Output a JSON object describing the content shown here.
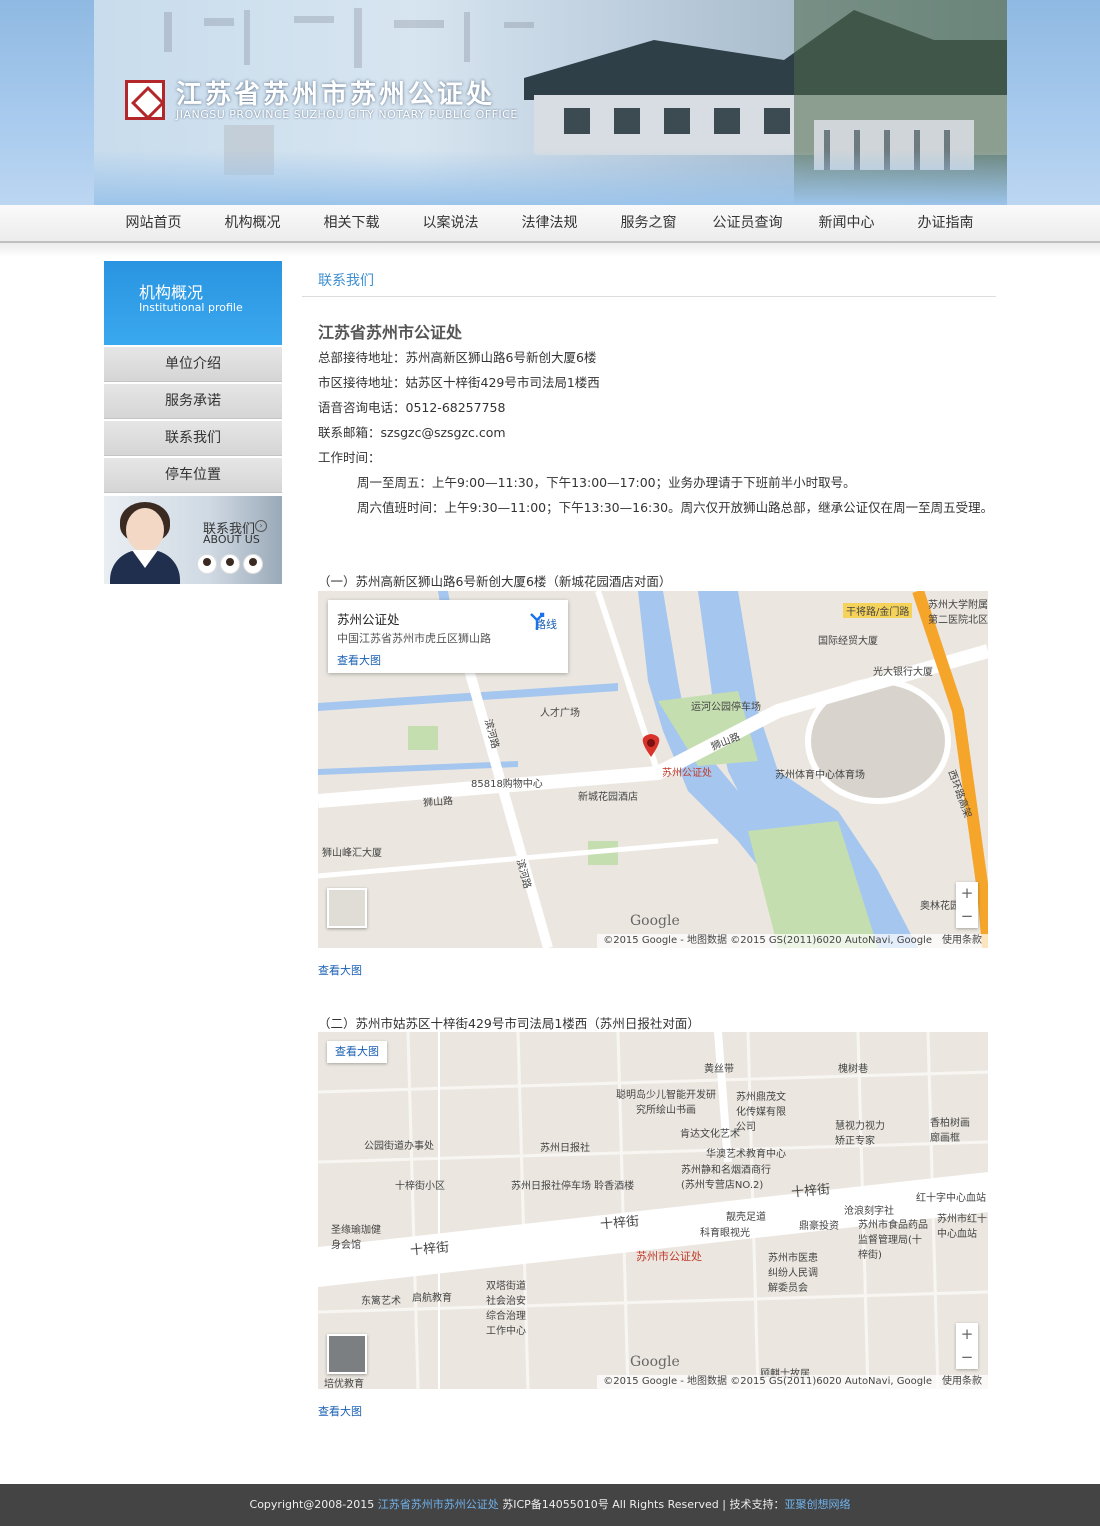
{
  "header": {
    "title": "江苏省苏州市苏州公证处",
    "subtitle": "JIANGSU PROVINCE SUZHOU CITY NOTARY PUBLIC OFFICE"
  },
  "nav": [
    "网站首页",
    "机构概况",
    "相关下载",
    "以案说法",
    "法律法规",
    "服务之窗",
    "公证员查询",
    "新闻中心",
    "办证指南"
  ],
  "sidebar": {
    "title": "机构概况",
    "subtitle": "Institutional profile",
    "items": [
      "单位介绍",
      "服务承诺",
      "联系我们",
      "停车位置"
    ],
    "banner_cn": "联系我们",
    "banner_en": "ABOUT US"
  },
  "content": {
    "breadcrumb": "联系我们",
    "org_name": "江苏省苏州市公证处",
    "lines": [
      "总部接待地址：苏州高新区狮山路6号新创大厦6楼",
      "市区接待地址：姑苏区十梓街429号市司法局1楼西",
      "语音咨询电话：0512-68257758",
      "联系邮箱：szsgzc@szsgzc.com",
      "工作时间："
    ],
    "hours": [
      "周一至周五：上午9:00—11:30，下午13:00—17:00；业务办理请于下班前半小时取号。",
      "周六值班时间：上午9:30—11:00；下午13:30—16:30。周六仅开放狮山路总部，继承公证仅在周一至周五受理。"
    ]
  },
  "maps": [
    {
      "caption": "（一）苏州高新区狮山路6号新创大厦6楼（新城花园酒店对面）",
      "card_title": "苏州公证处",
      "card_address": "中国江苏省苏州市虎丘区狮山路",
      "card_route": "路线",
      "card_view": "查看大图",
      "labels": {
        "gj": "干将路/金门路",
        "hosp": "苏州大学附属第二医院北区",
        "intl": "国际经贸大厦",
        "gd": "光大银行大厦",
        "talent": "人才广场",
        "park": "运河公园停车场",
        "office": "苏州公证处",
        "gym": "苏州体育中心体育场",
        "mall": "85818购物中心",
        "hotel": "新城花园酒店",
        "ssroad1": "狮山路",
        "ssroad2": "狮山路",
        "bhroad1": "滨河路",
        "bhroad2": "滨河路",
        "xhroad": "西环路高架",
        "fh": "狮山峰汇大厦",
        "olym": "奥林花园"
      },
      "attribution": "©2015 Google - 地图数据 ©2015 GS(2011)6020 AutoNavi, Google　使用条款",
      "brand": "Google",
      "bottom_link": "查看大图"
    },
    {
      "caption": "（二）苏州市姑苏区十梓街429号市司法局1楼西（苏州日报社对面）",
      "view_button": "查看大图",
      "labels": {
        "hsd": "黄丝带",
        "hsx": "槐树巷",
        "smart": "聪明岛少儿智能开发研究所绘山书画",
        "dm": "苏州鼎茂文化传媒有限公司",
        "kd": "肯达文化艺术",
        "hsg": "慧视力视力矫正专家",
        "xbs": "香柏树画廊画框",
        "jd": "公园街道办事处",
        "rb": "苏州日报社",
        "hy": "华澳艺术教育中心",
        "jj": "苏州静和名烟酒商行(苏州专营店NO.2)",
        "szj": "十梓街小区",
        "rbp": "苏州日报社停车场 聆香酒楼",
        "szj_road1": "十梓街",
        "szj_road2": "十梓街",
        "szj_road3": "十梓街",
        "red": "红十字中心血站",
        "yl": "圣缘瑜珈健身会馆",
        "lk": "靓壳足道",
        "lq": "沧浪刻字社",
        "ky": "科育眼视光",
        "dh": "鼎豪投资",
        "food": "苏州市食品药品监督管理局(十梓街)",
        "notary": "苏州市公证处",
        "my": "苏州市医患纠纷人民调解委员会",
        "sta": "双塔街道社会治安综合治理工作中心",
        "dl": "东篱艺术",
        "qh": "启航教育",
        "py": "培优教育",
        "gl": "顾麒士故居",
        "red2": "苏州市红十中心血站"
      },
      "attribution": "©2015 Google - 地图数据 ©2015 GS(2011)6020 AutoNavi, Google　使用条款",
      "brand": "Google",
      "bottom_link": "查看大图"
    }
  ],
  "footer": {
    "copyright": "Copyright@2008-2015 ",
    "org": "江苏省苏州市苏州公证处",
    "icp": " 苏ICP备14055010号 All Rights Reserved | 技术支持：",
    "tech": "亚聚创想网络"
  },
  "colors": {
    "accent": "#3f8fd0",
    "side_head": "#2a94e0",
    "footer_bg": "#444444",
    "logo_red": "#b3262a"
  }
}
